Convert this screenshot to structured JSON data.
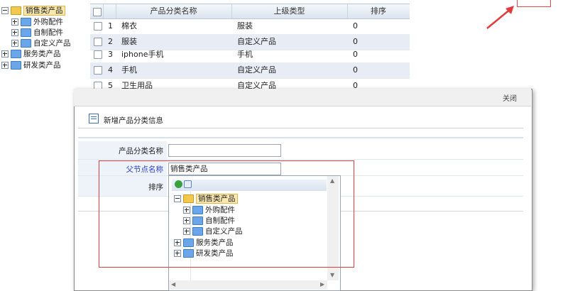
{
  "left_tree": {
    "root": {
      "label": "销售类产品",
      "selected": true
    },
    "children": [
      {
        "label": "外购配件"
      },
      {
        "label": "自制配件"
      },
      {
        "label": "自定义产品"
      }
    ],
    "siblings": [
      {
        "label": "服务类产品"
      },
      {
        "label": "研发类产品"
      }
    ]
  },
  "grid": {
    "columns": [
      "产品分类名称",
      "上级类型",
      "排序"
    ],
    "rows": [
      {
        "num": "1",
        "name": "棉衣",
        "parent": "服装",
        "order": "0"
      },
      {
        "num": "2",
        "name": "服装",
        "parent": "自定义产品",
        "order": "0"
      },
      {
        "num": "3",
        "name": "iphone手机",
        "parent": "手机",
        "order": "0"
      },
      {
        "num": "4",
        "name": "手机",
        "parent": "自定义产品",
        "order": "0"
      },
      {
        "num": "5",
        "name": "卫生用品",
        "parent": "自定义产品",
        "order": "0"
      }
    ]
  },
  "dialog": {
    "close_label": "关闭",
    "title": "新增产品分类信息",
    "fields": {
      "name_label": "产品分类名称",
      "name_value": "",
      "parent_label": "父节点名称",
      "parent_value": "销售类产品",
      "order_label": "排序"
    },
    "dropdown_tree": {
      "root": "销售类产品",
      "children": [
        "外购配件",
        "自制配件",
        "自定义产品"
      ],
      "siblings": [
        "服务类产品",
        "研发类产品"
      ]
    }
  },
  "colors": {
    "annotation": "#e23b3b",
    "header_bg": "#dbe4ef",
    "row_alt": "#e8edf5"
  }
}
